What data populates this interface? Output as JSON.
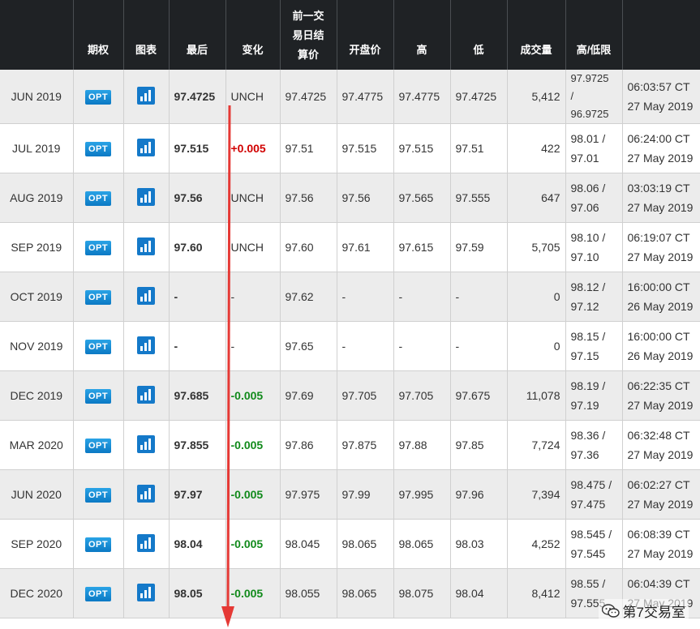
{
  "headers": {
    "col1": "",
    "options": "期权",
    "chart": "图表",
    "last": "最后",
    "change": "变化",
    "prior_settle_line1": "前一交",
    "prior_settle_line2": "易日结",
    "prior_settle_line3": "算价",
    "open": "开盘价",
    "high": "高",
    "low": "低",
    "volume": "成交量",
    "hilo_limit": "高/低限",
    "updated": ""
  },
  "opt_label": "OPT",
  "icons": {
    "options": "opt-badge",
    "chart": "bar-chart-icon",
    "watermark": "wechat-icon"
  },
  "colors": {
    "header_bg": "#1f2225",
    "up": "#d10000",
    "down": "#118a1b",
    "opt_blue": "#0b79c4",
    "arrow_red": "#e53935"
  },
  "rows": [
    {
      "month": "JUN 2019",
      "last": "97.4725",
      "change": "UNCH",
      "trend": "unch",
      "prior": "97.4725",
      "open": "97.4775",
      "high": "97.4775",
      "low": "97.4725",
      "volume": "5,412",
      "hilo1": "97.9725",
      "hilo2": "/",
      "hilo3": "96.9725",
      "time": "06:03:57 CT",
      "date": "27 May 2019"
    },
    {
      "month": "JUL 2019",
      "last": "97.515",
      "change": "+0.005",
      "trend": "up",
      "prior": "97.51",
      "open": "97.515",
      "high": "97.515",
      "low": "97.51",
      "volume": "422",
      "hilo1": "98.01 /",
      "hilo2": "97.01",
      "hilo3": "",
      "time": "06:24:00 CT",
      "date": "27 May 2019"
    },
    {
      "month": "AUG 2019",
      "last": "97.56",
      "change": "UNCH",
      "trend": "unch",
      "prior": "97.56",
      "open": "97.56",
      "high": "97.565",
      "low": "97.555",
      "volume": "647",
      "hilo1": "98.06 /",
      "hilo2": "97.06",
      "hilo3": "",
      "time": "03:03:19 CT",
      "date": "27 May 2019"
    },
    {
      "month": "SEP 2019",
      "last": "97.60",
      "change": "UNCH",
      "trend": "unch",
      "prior": "97.60",
      "open": "97.61",
      "high": "97.615",
      "low": "97.59",
      "volume": "5,705",
      "hilo1": "98.10 /",
      "hilo2": "97.10",
      "hilo3": "",
      "time": "06:19:07 CT",
      "date": "27 May 2019"
    },
    {
      "month": "OCT 2019",
      "last": "-",
      "change": "-",
      "trend": "unch",
      "prior": "97.62",
      "open": "-",
      "high": "-",
      "low": "-",
      "volume": "0",
      "hilo1": "98.12 /",
      "hilo2": "97.12",
      "hilo3": "",
      "time": "16:00:00 CT",
      "date": "26 May 2019"
    },
    {
      "month": "NOV 2019",
      "last": "-",
      "change": "-",
      "trend": "unch",
      "prior": "97.65",
      "open": "-",
      "high": "-",
      "low": "-",
      "volume": "0",
      "hilo1": "98.15 /",
      "hilo2": "97.15",
      "hilo3": "",
      "time": "16:00:00 CT",
      "date": "26 May 2019"
    },
    {
      "month": "DEC 2019",
      "last": "97.685",
      "change": "-0.005",
      "trend": "down",
      "prior": "97.69",
      "open": "97.705",
      "high": "97.705",
      "low": "97.675",
      "volume": "11,078",
      "hilo1": "98.19 /",
      "hilo2": "97.19",
      "hilo3": "",
      "time": "06:22:35 CT",
      "date": "27 May 2019"
    },
    {
      "month": "MAR 2020",
      "last": "97.855",
      "change": "-0.005",
      "trend": "down",
      "prior": "97.86",
      "open": "97.875",
      "high": "97.88",
      "low": "97.85",
      "volume": "7,724",
      "hilo1": "98.36 /",
      "hilo2": "97.36",
      "hilo3": "",
      "time": "06:32:48 CT",
      "date": "27 May 2019"
    },
    {
      "month": "JUN 2020",
      "last": "97.97",
      "change": "-0.005",
      "trend": "down",
      "prior": "97.975",
      "open": "97.99",
      "high": "97.995",
      "low": "97.96",
      "volume": "7,394",
      "hilo1": "98.475 /",
      "hilo2": "97.475",
      "hilo3": "",
      "time": "06:02:27 CT",
      "date": "27 May 2019"
    },
    {
      "month": "SEP 2020",
      "last": "98.04",
      "change": "-0.005",
      "trend": "down",
      "prior": "98.045",
      "open": "98.065",
      "high": "98.065",
      "low": "98.03",
      "volume": "4,252",
      "hilo1": "98.545 /",
      "hilo2": "97.545",
      "hilo3": "",
      "time": "06:08:39 CT",
      "date": "27 May 2019"
    },
    {
      "month": "DEC 2020",
      "last": "98.05",
      "change": "-0.005",
      "trend": "down",
      "prior": "98.055",
      "open": "98.065",
      "high": "98.075",
      "low": "98.04",
      "volume": "8,412",
      "hilo1": "98.55 /",
      "hilo2": "97.555",
      "hilo3": "",
      "time": "06:04:39 CT",
      "date": "27 May 2019"
    }
  ],
  "watermark": {
    "text": "第7交易室"
  }
}
